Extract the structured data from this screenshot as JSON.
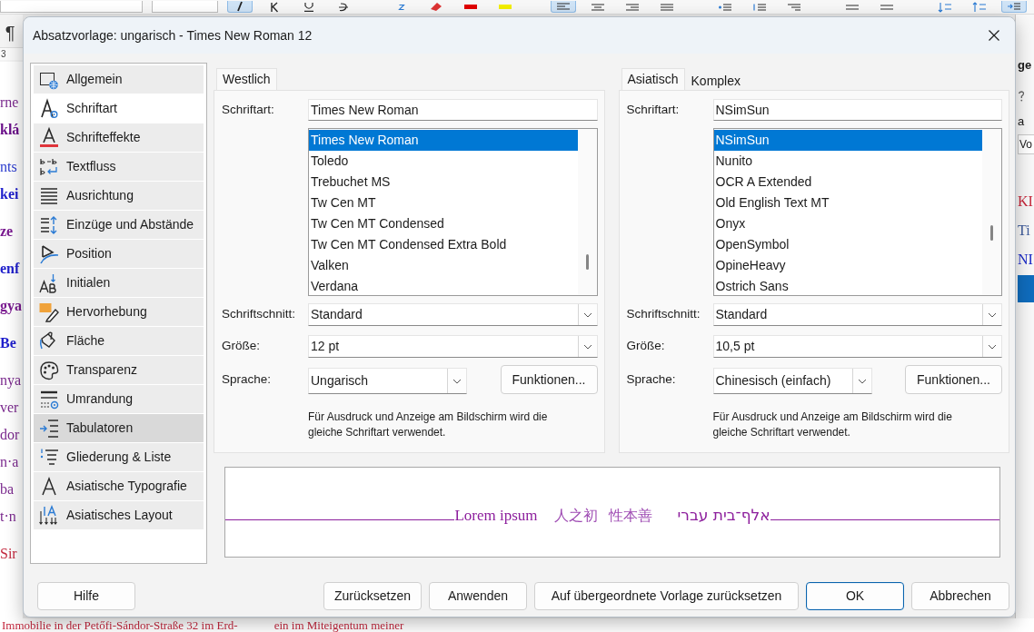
{
  "background_window": {
    "toolbar": {
      "buttons": [
        {
          "on": true
        },
        {
          "on": false
        },
        {
          "on": false
        },
        {
          "on": false
        },
        {
          "on": false
        },
        {
          "on": false
        },
        {
          "on": false
        },
        {
          "on": false
        },
        {
          "on": true
        },
        {
          "on": false
        },
        {
          "on": false
        },
        {
          "on": false
        },
        {
          "on": false
        },
        {
          "on": false
        },
        {
          "on": false
        },
        {
          "on": false
        },
        {
          "on": false
        },
        {
          "on": false
        },
        {
          "on": false
        },
        {
          "on": true
        }
      ]
    },
    "formatting_marks_button": "¶",
    "ruler_number": "3",
    "document": {
      "paragraphs": [
        {
          "lines": [
            {
              "text": "rne",
              "color": "#7b2a8e",
              "bold": false
            },
            {
              "text": "klá",
              "color": "#6b108a",
              "bold": true
            }
          ]
        },
        {
          "lines": [
            {
              "text": "nts",
              "color": "#2b3ccf",
              "bold": false
            },
            {
              "text": "kei",
              "color": "#1f1fcc",
              "bold": true
            }
          ]
        },
        {
          "lines": [
            {
              "text": "ze",
              "color": "#7a1a90",
              "bold": true
            }
          ]
        },
        {
          "lines": [
            {
              "text": "enf",
              "color": "#1f1fcc",
              "bold": true
            }
          ]
        },
        {
          "lines": [
            {
              "text": "gya",
              "color": "#7a1a90",
              "bold": true
            }
          ]
        },
        {
          "lines": [
            {
              "text": "Be",
              "color": "#1f1fcc",
              "bold": true
            }
          ]
        },
        {
          "lines": [
            {
              "text": "nya",
              "color": "#7b2a8e",
              "bold": false
            },
            {
              "text": "ver",
              "color": "#7b2a8e",
              "bold": false
            },
            {
              "text": "dor",
              "color": "#7b2a8e",
              "bold": false
            },
            {
              "text": "n·a",
              "color": "#7b2a8e",
              "bold": false
            },
            {
              "text": "ba",
              "color": "#7b2a8e",
              "bold": false
            },
            {
              "text": "t·n",
              "color": "#7b2a8e",
              "bold": false
            }
          ]
        },
        {
          "lines": [
            {
              "text": "Sir",
              "color": "#c3283e",
              "bold": false
            }
          ]
        }
      ],
      "lines_below_dialog": [
        {
          "text": "Immobilie in der Petőfi-Sándor-Straße 32 im Erd-",
          "color": "#c3283e"
        },
        {
          "text": "ein im Miteigentum meiner",
          "color": "#c3283e"
        }
      ]
    },
    "sidebar_deck": {
      "title": "ge",
      "text": "a",
      "field_value": "Vo",
      "styles": [
        {
          "text": "KI",
          "color": "#c8283c",
          "selected": false
        },
        {
          "text": "Ti",
          "color": "#3c5a9a",
          "selected": false
        },
        {
          "text": "NI",
          "color": "#1a2ac8",
          "selected": false
        },
        {
          "selected": true
        }
      ]
    }
  },
  "dialog": {
    "title": "Absatzvorlage: ungarisch - Times New Roman 12",
    "categories": [
      {
        "label": "Allgemein",
        "selected": false,
        "hovered": false
      },
      {
        "label": "Schriftart",
        "selected": true,
        "hovered": false
      },
      {
        "label": "Schrifteffekte",
        "selected": false,
        "hovered": false
      },
      {
        "label": "Textfluss",
        "selected": false,
        "hovered": false
      },
      {
        "label": "Ausrichtung",
        "selected": false,
        "hovered": false
      },
      {
        "label": "Einzüge und Abstände",
        "selected": false,
        "hovered": false
      },
      {
        "label": "Position",
        "selected": false,
        "hovered": false
      },
      {
        "label": "Initialen",
        "selected": false,
        "hovered": false
      },
      {
        "label": "Hervorhebung",
        "selected": false,
        "hovered": false
      },
      {
        "label": "Fläche",
        "selected": false,
        "hovered": false
      },
      {
        "label": "Transparenz",
        "selected": false,
        "hovered": false
      },
      {
        "label": "Umrandung",
        "selected": false,
        "hovered": false
      },
      {
        "label": "Tabulatoren",
        "selected": false,
        "hovered": true
      },
      {
        "label": "Gliederung & Liste",
        "selected": false,
        "hovered": false
      },
      {
        "label": "Asiatische Typografie",
        "selected": false,
        "hovered": false
      },
      {
        "label": "Asiatisches Layout",
        "selected": false,
        "hovered": false
      }
    ],
    "font_groups": [
      {
        "tabs": [
          {
            "label": "Westlich",
            "selected": true
          }
        ],
        "font_label": "Schriftart:",
        "font_name": "Times New Roman",
        "font_list": [
          {
            "name": "Times New Roman",
            "selected": true
          },
          {
            "name": "Toledo",
            "selected": false
          },
          {
            "name": "Trebuchet MS",
            "selected": false
          },
          {
            "name": "Tw Cen MT",
            "selected": false
          },
          {
            "name": "Tw Cen MT Condensed",
            "selected": false
          },
          {
            "name": "Tw Cen MT Condensed Extra Bold",
            "selected": false
          },
          {
            "name": "Valken",
            "selected": false
          },
          {
            "name": "Verdana",
            "selected": false
          }
        ],
        "style_label": "Schriftschnitt:",
        "style": "Standard",
        "size_label": "Größe:",
        "size": "12 pt",
        "language_label": "Sprache:",
        "language": "Ungarisch",
        "features_button": "Funktionen...",
        "note": "Für Ausdruck und Anzeige am Bildschirm wird die gleiche Schriftart verwendet."
      },
      {
        "tabs": [
          {
            "label": "Asiatisch",
            "selected": true
          },
          {
            "label": "Komplex",
            "selected": false
          }
        ],
        "font_label": "Schriftart:",
        "font_name": "NSimSun",
        "font_list": [
          {
            "name": "NSimSun",
            "selected": true
          },
          {
            "name": "Nunito",
            "selected": false
          },
          {
            "name": "OCR A Extended",
            "selected": false
          },
          {
            "name": "Old English Text MT",
            "selected": false
          },
          {
            "name": "Onyx",
            "selected": false
          },
          {
            "name": "OpenSymbol",
            "selected": false
          },
          {
            "name": "OpineHeavy",
            "selected": false
          },
          {
            "name": "Ostrich Sans",
            "selected": false
          }
        ],
        "style_label": "Schriftschnitt:",
        "style": "Standard",
        "size_label": "Größe:",
        "size": "10,5 pt",
        "language_label": "Sprache:",
        "language": "Chinesisch (einfach)",
        "features_button": "Funktionen...",
        "note": "Für Ausdruck und Anzeige am Bildschirm wird die gleiche Schriftart verwendet."
      }
    ],
    "preview": {
      "western": "Lorem ipsum",
      "asian": "人之初 性本善",
      "complex": "אלף־בית עברי"
    },
    "buttons": [
      {
        "label": "Hilfe",
        "kind": "help"
      },
      {
        "label": "Zurücksetzen",
        "kind": "normal"
      },
      {
        "label": "Anwenden",
        "kind": "normal"
      },
      {
        "label": "Auf übergeordnete Vorlage zurücksetzen",
        "kind": "normal"
      },
      {
        "label": "OK",
        "kind": "default"
      },
      {
        "label": "Abbrechen",
        "kind": "normal"
      }
    ]
  }
}
